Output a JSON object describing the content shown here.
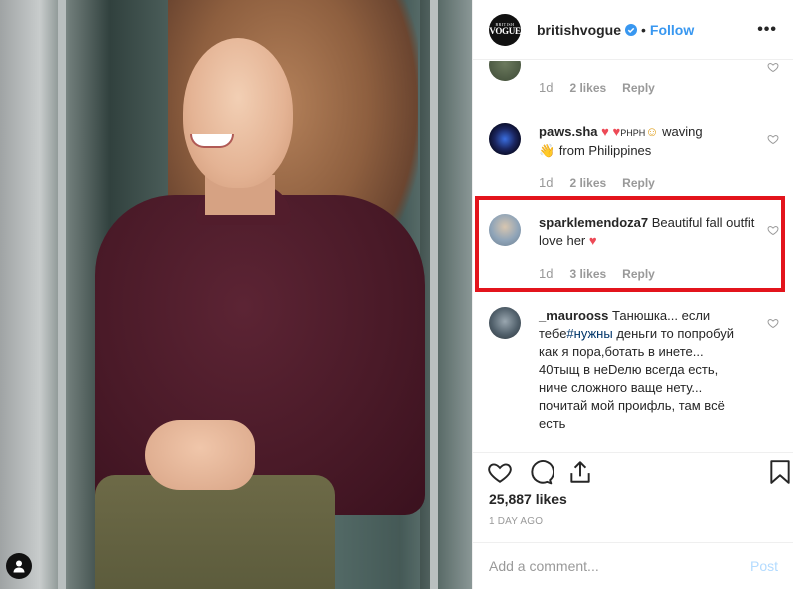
{
  "post": {
    "username": "britishvogue",
    "logo_line1": "BRITISH",
    "logo_line2": "VOGUE",
    "separator": "•",
    "follow_label": "Follow",
    "more_label": "•••",
    "likes": "25,887 likes",
    "date": "1 DAY AGO"
  },
  "comments": [
    {
      "username": "",
      "text": "",
      "time": "1d",
      "likes": "2 likes",
      "reply": "Reply"
    },
    {
      "username": "paws.sha",
      "text_a": " ",
      "emoji_a": "♥",
      "text_b": " ",
      "emoji_b": "♥",
      "text_c": "PHPH",
      "emoji_c": "☺",
      "text_d": " waving",
      "emoji_d": "👋",
      "text_e": " from Philippines",
      "time": "1d",
      "likes": "2 likes",
      "reply": "Reply"
    },
    {
      "username": "sparklemendoza7",
      "text": " Beautiful fall outfit love her ",
      "emoji": "♥",
      "time": "1d",
      "likes": "3 likes",
      "reply": "Reply"
    },
    {
      "username": "_maurooss",
      "text_a": " Танюшка... если тебе",
      "tag": "#нужны",
      "text_b": " деньги то попробуй как я пора,ботать в инете... 40тыщ в неDелю всегда есть, ниче сложного ваще нету... почитай мой проифль, там всё есть"
    }
  ],
  "add_comment": {
    "placeholder": "Add a comment...",
    "post_label": "Post"
  },
  "colors": {
    "accent": "#3897f0",
    "highlight": "#e3141c",
    "heart_red": "#ed4956"
  }
}
